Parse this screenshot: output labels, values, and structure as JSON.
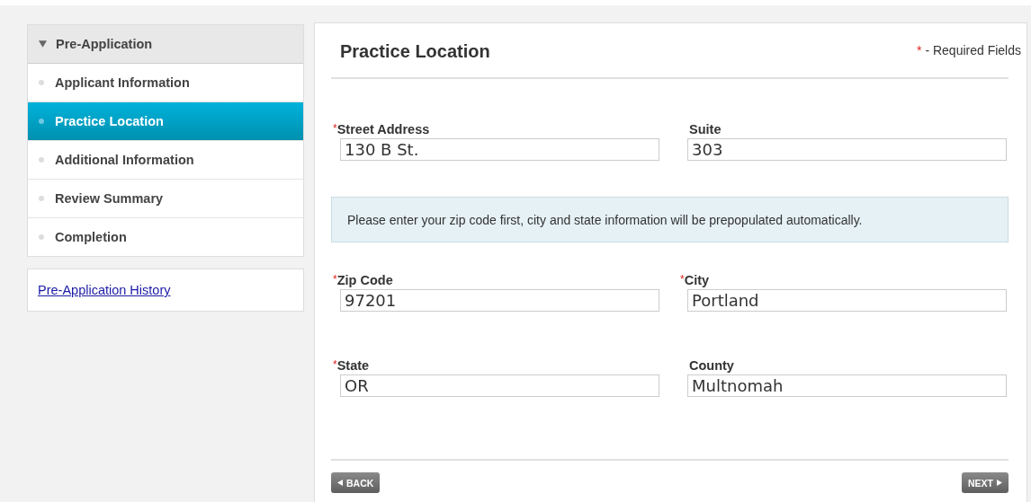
{
  "sidebar": {
    "header": {
      "label": "Pre-Application",
      "expanded": true
    },
    "items": [
      {
        "label": "Applicant Information",
        "selected": false
      },
      {
        "label": "Practice Location",
        "selected": true
      },
      {
        "label": "Additional Information",
        "selected": false
      },
      {
        "label": "Review Summary",
        "selected": false
      },
      {
        "label": "Completion",
        "selected": false
      }
    ],
    "history_link": "Pre-Application History"
  },
  "main": {
    "title": "Practice Location",
    "required_note": {
      "mark": "*",
      "text": "- Required Fields"
    },
    "sections": [
      {
        "kind": "fields",
        "fields": [
          {
            "label": "Street Address",
            "required": true,
            "value": "130 B St."
          },
          {
            "label": "Suite",
            "required": false,
            "value": "303"
          }
        ]
      },
      {
        "kind": "notice",
        "text": "Please enter your zip code first, city and state information will be prepopulated automatically."
      },
      {
        "kind": "fields",
        "fields": [
          {
            "label": "Zip Code",
            "required": true,
            "value": "97201"
          },
          {
            "label": "City",
            "required": true,
            "value": "Portland"
          }
        ]
      },
      {
        "kind": "fields",
        "fields": [
          {
            "label": "State",
            "required": true,
            "value": "OR"
          },
          {
            "label": "County",
            "required": false,
            "value": "Multnomah"
          }
        ]
      }
    ],
    "buttons": {
      "back": "BACK",
      "next": "NEXT"
    }
  }
}
